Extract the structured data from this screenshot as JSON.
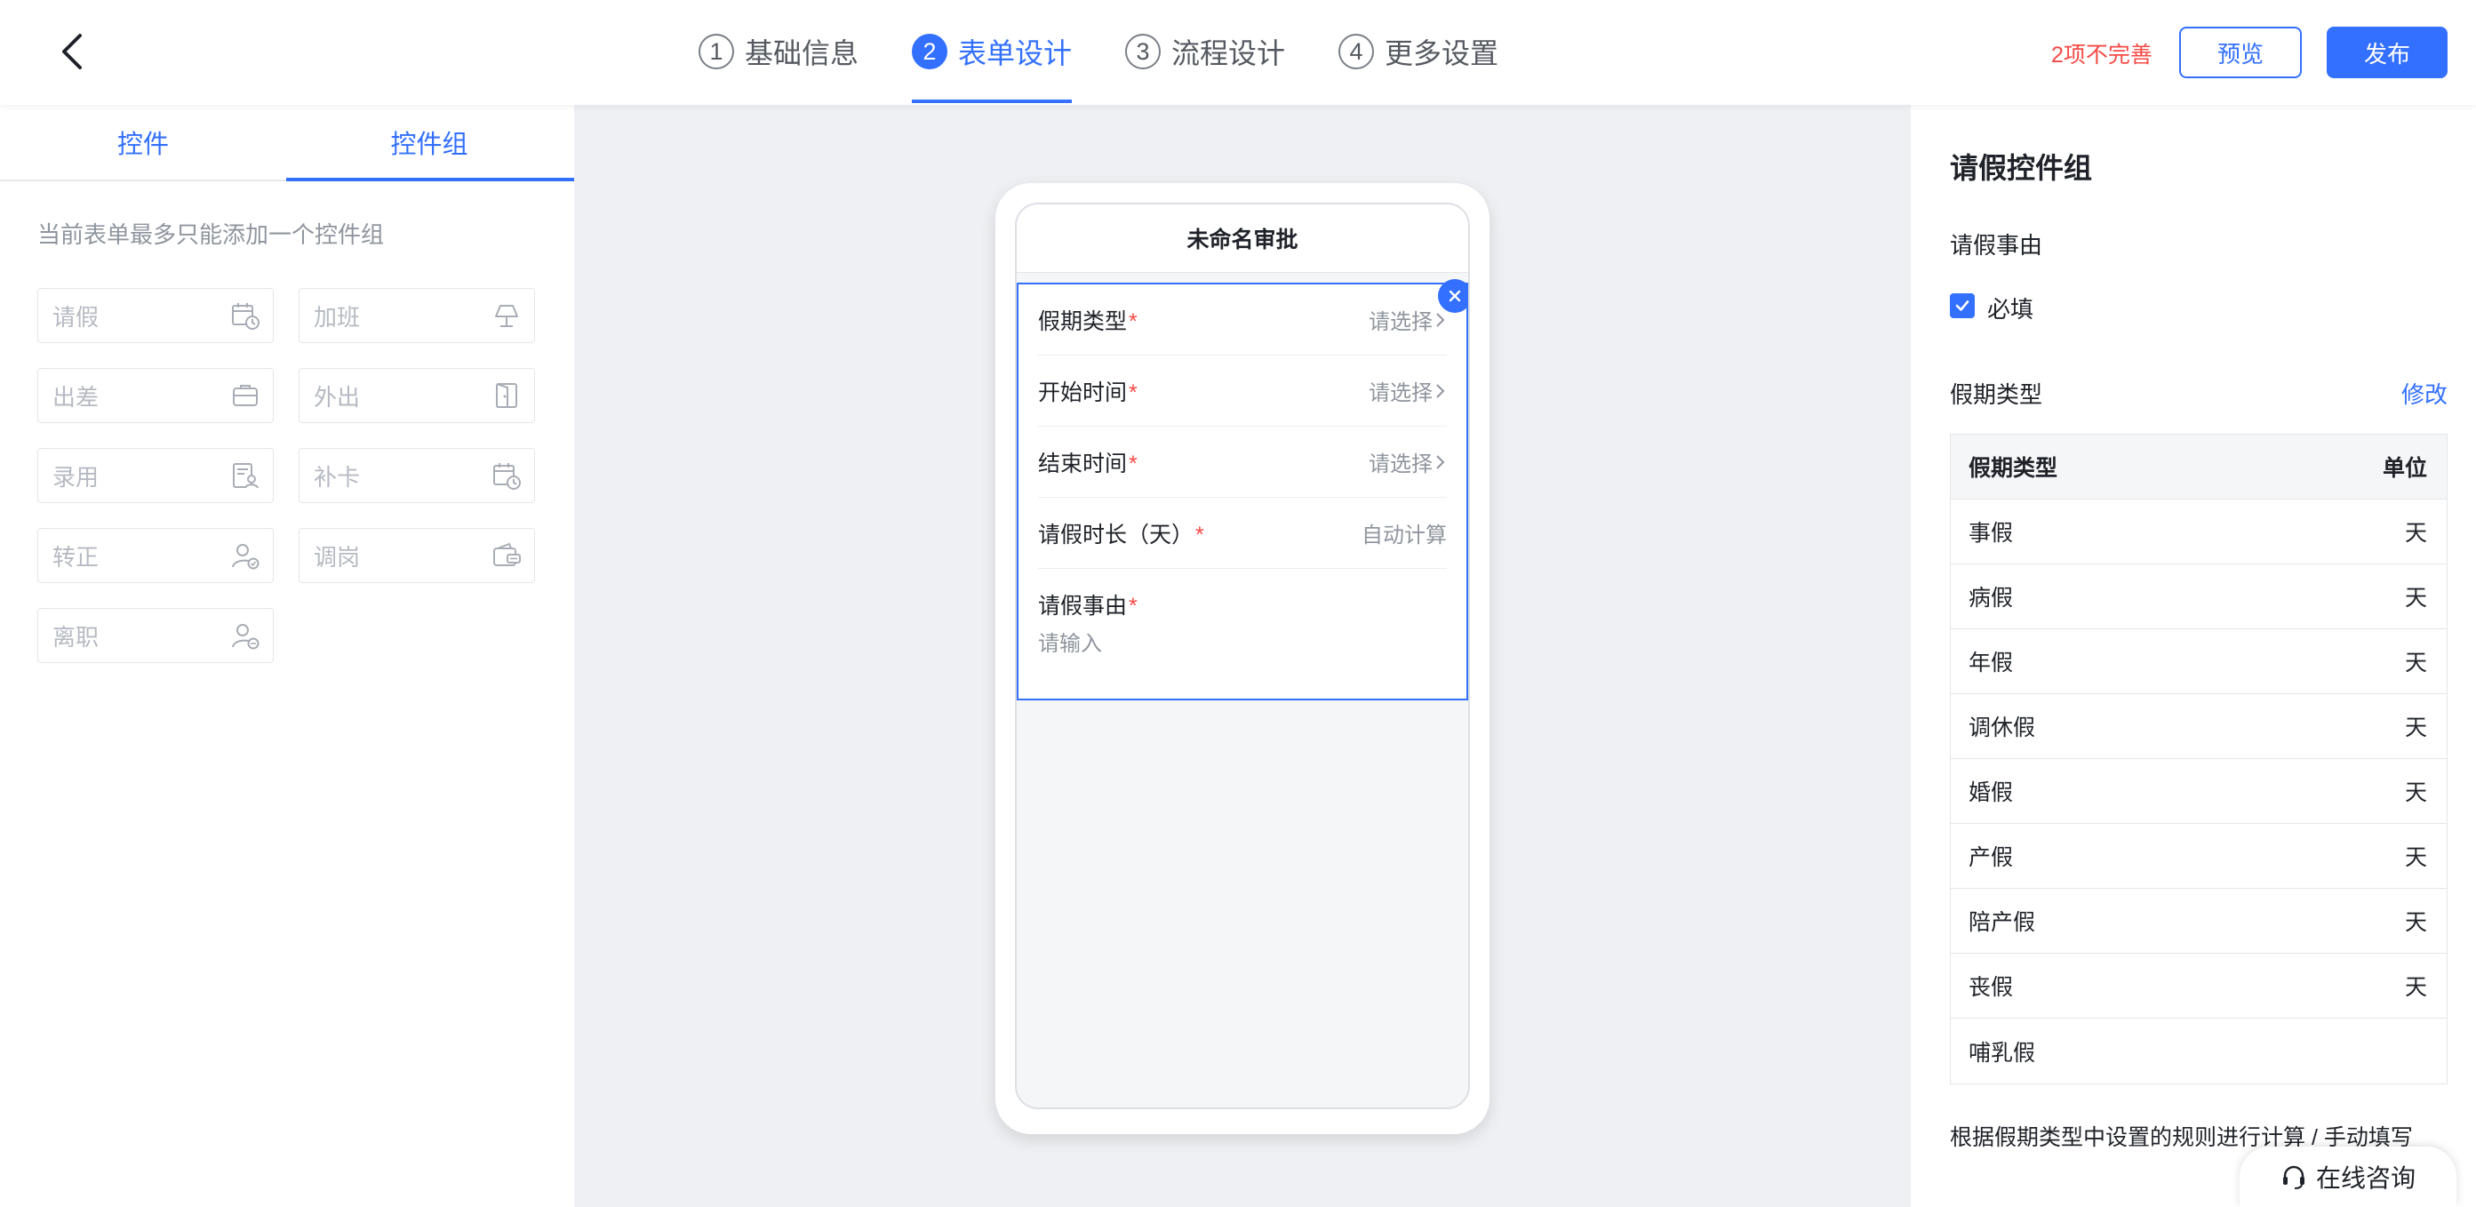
{
  "header": {
    "steps": [
      {
        "num": "1",
        "label": "基础信息"
      },
      {
        "num": "2",
        "label": "表单设计"
      },
      {
        "num": "3",
        "label": "流程设计"
      },
      {
        "num": "4",
        "label": "更多设置"
      }
    ],
    "active_step": 2,
    "incomplete_text": "2项不完善",
    "preview_label": "预览",
    "publish_label": "发布",
    "accent_color": "#3370ff",
    "warning_color": "#f54a45"
  },
  "left_panel": {
    "tabs": [
      "控件",
      "控件组"
    ],
    "active_tab": "控件组",
    "hint": "当前表单最多只能添加一个控件组",
    "controls": [
      {
        "label": "请假",
        "icon": "calendar-clock-icon"
      },
      {
        "label": "加班",
        "icon": "lamp-icon"
      },
      {
        "label": "出差",
        "icon": "briefcase-icon"
      },
      {
        "label": "外出",
        "icon": "door-exit-icon"
      },
      {
        "label": "录用",
        "icon": "document-person-icon"
      },
      {
        "label": "补卡",
        "icon": "calendar-clock-icon"
      },
      {
        "label": "转正",
        "icon": "user-check-icon"
      },
      {
        "label": "调岗",
        "icon": "wallet-transfer-icon"
      },
      {
        "label": "离职",
        "icon": "user-remove-icon"
      }
    ]
  },
  "preview": {
    "title": "未命名审批",
    "fields": [
      {
        "label": "假期类型",
        "value": "请选择"
      },
      {
        "label": "开始时间",
        "value": "请选择"
      },
      {
        "label": "结束时间",
        "value": "请选择"
      },
      {
        "label": "请假时长（天）",
        "value": "自动计算"
      }
    ],
    "reason_label": "请假事由",
    "reason_placeholder": "请输入",
    "required_mark": "*"
  },
  "right_panel": {
    "title": "请假控件组",
    "reason_section": "请假事由",
    "required_label": "必填",
    "required_checked": true,
    "leave_type_title": "假期类型",
    "edit_label": "修改",
    "table_headers": [
      "假期类型",
      "单位"
    ],
    "leave_types": [
      {
        "name": "事假",
        "unit": "天"
      },
      {
        "name": "病假",
        "unit": "天"
      },
      {
        "name": "年假",
        "unit": "天"
      },
      {
        "name": "调休假",
        "unit": "天"
      },
      {
        "name": "婚假",
        "unit": "天"
      },
      {
        "name": "产假",
        "unit": "天"
      },
      {
        "name": "陪产假",
        "unit": "天"
      },
      {
        "name": "丧假",
        "unit": "天"
      },
      {
        "name": "哺乳假",
        "unit": ""
      }
    ],
    "note": "根据假期类型中设置的规则进行计算 / 手动填写"
  },
  "consult_label": "在线咨询"
}
